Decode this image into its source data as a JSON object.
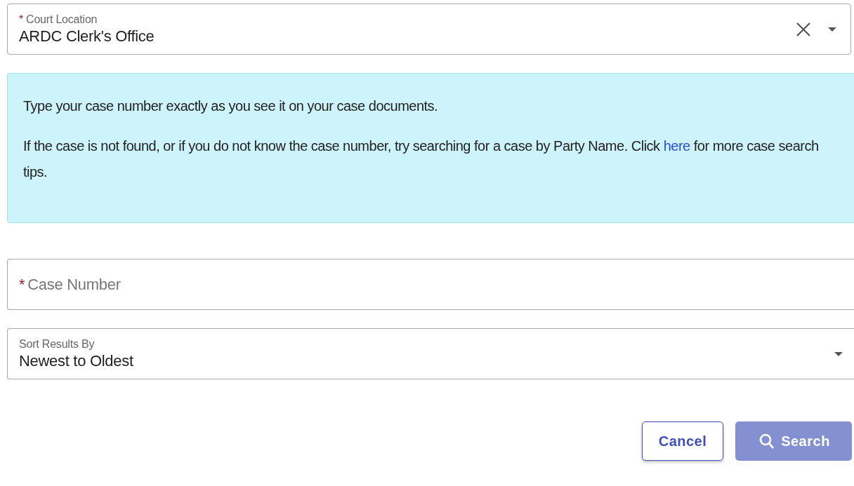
{
  "court_location": {
    "label": "Court Location",
    "required_mark": "*",
    "value": "ARDC Clerk's Office",
    "clearable": true
  },
  "info": {
    "paragraphs": [
      {
        "text": "Type your case number exactly as you see it on your case documents."
      },
      {
        "text": "If the case is not found, or if you do not know the case number, try searching for a case by Party Name. Click ",
        "link": "here",
        "after": " for more case search tips."
      }
    ]
  },
  "case_number": {
    "label": "Case Number",
    "required_mark": "*"
  },
  "sort": {
    "label": "Sort Results By",
    "value": "Newest to Oldest"
  },
  "buttons": [
    {
      "label": "Cancel",
      "kind": "outline",
      "disabled": false
    },
    {
      "label": "Search",
      "kind": "primary",
      "disabled": true
    }
  ]
}
